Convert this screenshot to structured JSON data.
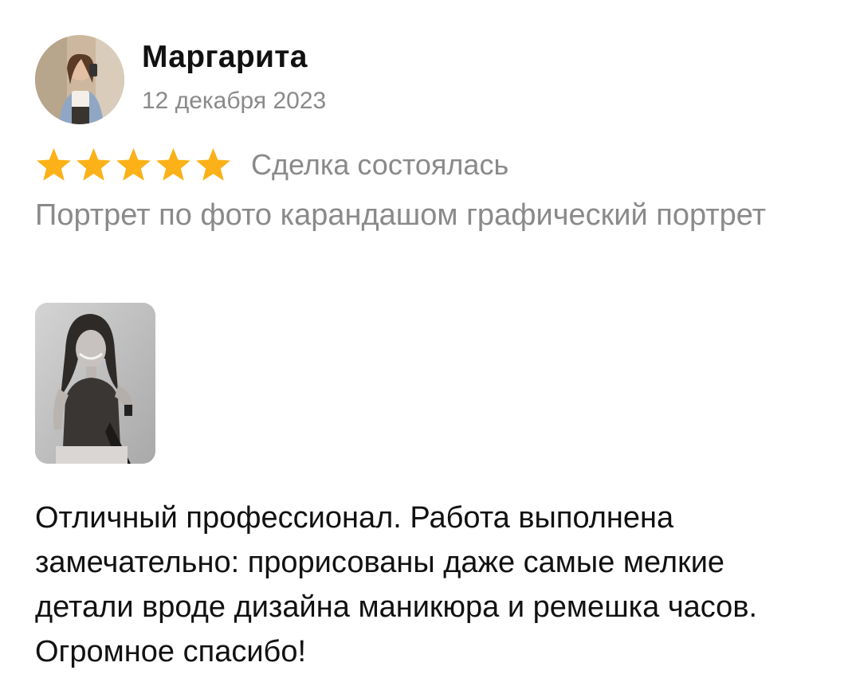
{
  "review": {
    "author_name": "Маргарита",
    "date": "12 декабря 2023",
    "rating": 5,
    "rating_max": 5,
    "deal_status": "Сделка состоялась",
    "service_title": "Портрет по фото карандашом графический портрет",
    "text": "Отличный профессионал. Работа выполнена замечательно: прорисованы даже самые мелкие детали вроде дизайна маникюра и ремешка часов. Огромное спасибо!",
    "star_color": "#FBB117",
    "avatar_icon": "user-photo",
    "attached_photo_icon": "portrait-photo"
  }
}
